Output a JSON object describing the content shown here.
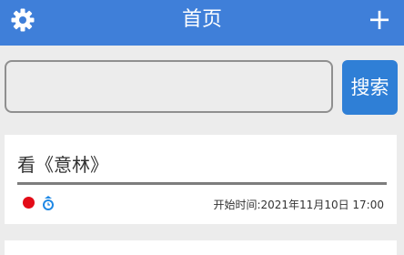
{
  "header": {
    "title": "首页",
    "add_label": "+",
    "color": "#3f7fd9",
    "icons": {
      "settings": "gear-icon",
      "add": "plus-icon"
    }
  },
  "search": {
    "value": "",
    "placeholder": "",
    "button_label": "搜索",
    "button_color": "#2f7fd6"
  },
  "tasks": [
    {
      "title": "看《意林》",
      "status_color": "#e30b17",
      "type_icon": "clock-icon",
      "start_time": "开始时间:2021年11月10日 17:00"
    }
  ]
}
